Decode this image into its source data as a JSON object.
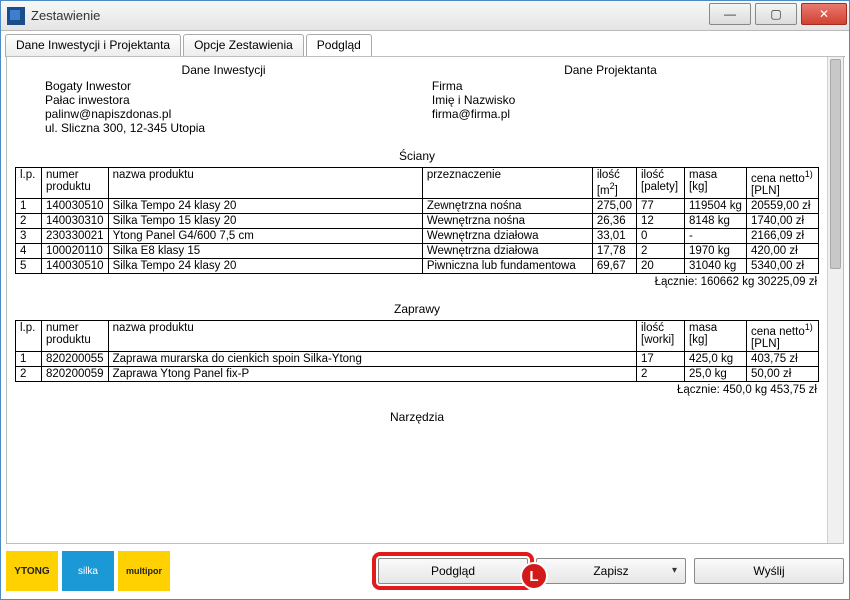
{
  "window": {
    "title": "Zestawienie"
  },
  "tabs": [
    {
      "label": "Dane Inwestycji i Projektanta"
    },
    {
      "label": "Opcje Zestawienia"
    },
    {
      "label": "Podgląd"
    }
  ],
  "investment": {
    "heading": "Dane Inwestycji",
    "line1": "Bogaty Inwestor",
    "line2": "Pałac inwestora",
    "line3": "palinw@napiszdonas.pl",
    "line4": "ul. Sliczna 300, 12-345 Utopia"
  },
  "designer": {
    "heading": "Dane Projektanta",
    "line1": "Firma",
    "line2": "Imię i Nazwisko",
    "line3": "firma@firma.pl"
  },
  "walls": {
    "title": "Ściany",
    "headers": {
      "lp": "l.p.",
      "numer": "numer produktu",
      "nazwa": "nazwa produktu",
      "przeznaczenie": "przeznaczenie",
      "ilosc_m2": "ilość [m²]",
      "ilosc_pal": "ilość [palety]",
      "masa": "masa [kg]",
      "cena": "cena netto¹⁾ [PLN]"
    },
    "rows": [
      {
        "lp": "1",
        "numer": "140030510",
        "nazwa": "Silka Tempo 24 klasy 20",
        "przez": "Zewnętrzna nośna",
        "m2": "275,00",
        "pal": "77",
        "masa": "119504 kg",
        "cena": "20559,00 zł"
      },
      {
        "lp": "2",
        "numer": "140030310",
        "nazwa": "Silka Tempo 15 klasy 20",
        "przez": "Wewnętrzna nośna",
        "m2": "26,36",
        "pal": "12",
        "masa": "8148 kg",
        "cena": "1740,00 zł"
      },
      {
        "lp": "3",
        "numer": "230330021",
        "nazwa": "Ytong Panel G4/600 7,5 cm",
        "przez": "Wewnętrzna działowa",
        "m2": "33,01",
        "pal": "0",
        "masa": "-",
        "cena": "2166,09 zł"
      },
      {
        "lp": "4",
        "numer": "100020110",
        "nazwa": "Silka E8 klasy 15",
        "przez": "Wewnętrzna działowa",
        "m2": "17,78",
        "pal": "2",
        "masa": "1970 kg",
        "cena": "420,00 zł"
      },
      {
        "lp": "5",
        "numer": "140030510",
        "nazwa": "Silka Tempo 24 klasy 20",
        "przez": "Piwniczna lub fundamentowa",
        "m2": "69,67",
        "pal": "20",
        "masa": "31040 kg",
        "cena": "5340,00 zł"
      }
    ],
    "summary": "Łącznie: 160662 kg 30225,09 zł"
  },
  "mortars": {
    "title": "Zaprawy",
    "headers": {
      "lp": "l.p.",
      "numer": "numer produktu",
      "nazwa": "nazwa produktu",
      "ilosc_w": "ilość [worki]",
      "masa": "masa [kg]",
      "cena": "cena netto¹⁾ [PLN]"
    },
    "rows": [
      {
        "lp": "1",
        "numer": "820200055",
        "nazwa": "Zaprawa murarska do cienkich spoin Silka-Ytong",
        "worki": "17",
        "masa": "425,0 kg",
        "cena": "403,75 zł"
      },
      {
        "lp": "2",
        "numer": "820200059",
        "nazwa": "Zaprawa Ytong Panel fix-P",
        "worki": "2",
        "masa": "25,0 kg",
        "cena": "50,00 zł"
      }
    ],
    "summary": "Łącznie: 450,0 kg 453,75 zł"
  },
  "tools_title": "Narzędzia",
  "brands": {
    "ytong": "YTONG",
    "silka": "silka",
    "multipor": "multipor"
  },
  "buttons": {
    "preview": "Podgląd",
    "save": "Zapisz",
    "send": "Wyślij"
  },
  "badge": "L"
}
